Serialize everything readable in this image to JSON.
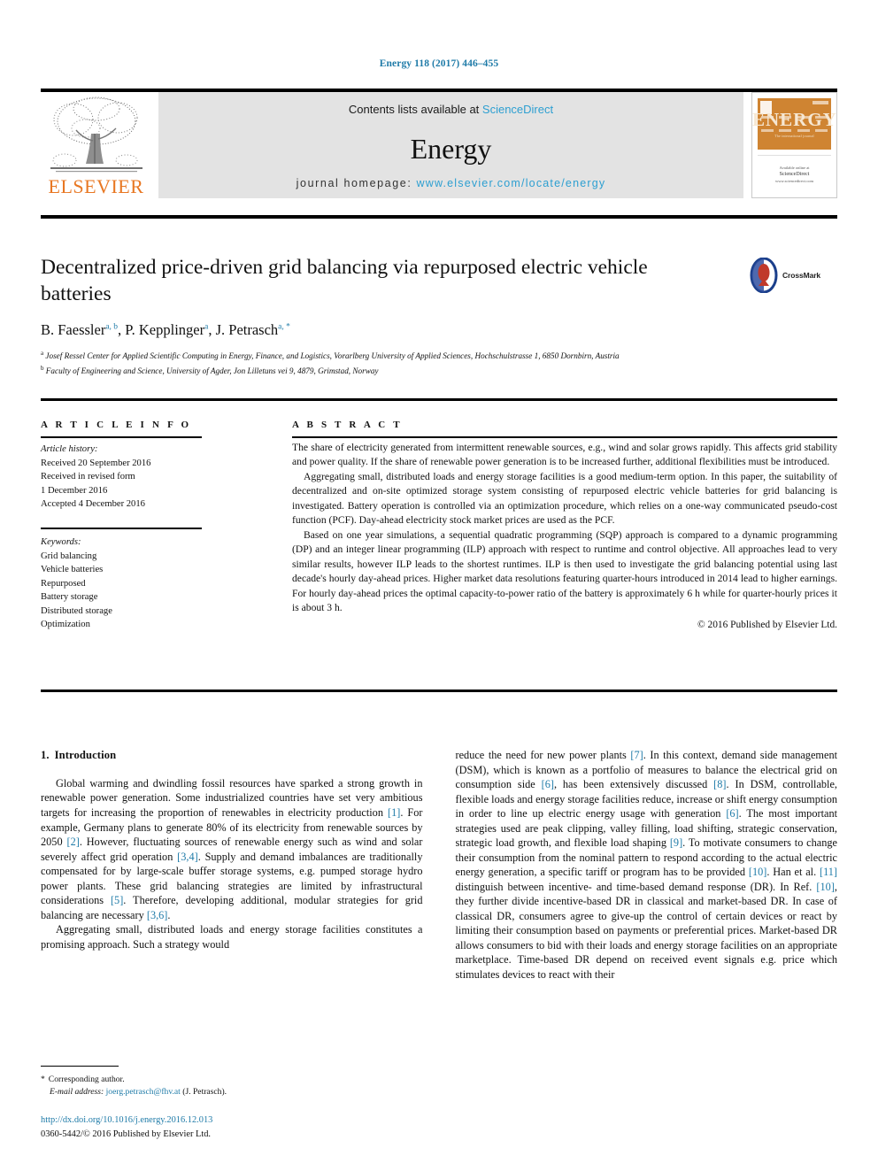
{
  "running_head": "Energy 118 (2017) 446–455",
  "masthead": {
    "contents_prefix": "Contents lists available at ",
    "sciencedirect": "ScienceDirect",
    "journal_name": "Energy",
    "homepage_label": "journal homepage: ",
    "homepage_url": "www.elsevier.com/locate/energy",
    "publisher": "ELSEVIER",
    "cover": {
      "word": "ENERGY",
      "tagline": "The international journal",
      "footer_small": "Available online at",
      "footer_big": "ScienceDirect",
      "footer_url": "www.sciencedirect.com"
    }
  },
  "title": "Decentralized price-driven grid balancing via repurposed electric vehicle batteries",
  "crossmark_label": "CrossMark",
  "authors": [
    {
      "name": "B. Faessler",
      "marks": "a, b",
      "sep": ", "
    },
    {
      "name": "P. Kepplinger",
      "marks": "a",
      "sep": ", "
    },
    {
      "name": "J. Petrasch",
      "marks": "a, *",
      "sep": ""
    }
  ],
  "affiliations": [
    {
      "mark": "a",
      "text": "Josef Ressel Center for Applied Scientific Computing in Energy, Finance, and Logistics, Vorarlberg University of Applied Sciences, Hochschulstrasse 1, 6850 Dornbirn, Austria"
    },
    {
      "mark": "b",
      "text": "Faculty of Engineering and Science, University of Agder, Jon Lilletuns vei 9, 4879, Grimstad, Norway"
    }
  ],
  "article_info": {
    "heading": "A R T I C L E  I N F O",
    "history_label": "Article history:",
    "history_lines": [
      "Received 20 September 2016",
      "Received in revised form",
      "1 December 2016",
      "Accepted 4 December 2016"
    ],
    "keywords_label": "Keywords:",
    "keywords": [
      "Grid balancing",
      "Vehicle batteries",
      "Repurposed",
      "Battery storage",
      "Distributed storage",
      "Optimization"
    ]
  },
  "abstract": {
    "heading": "A B S T R A C T",
    "paragraphs": [
      "The share of electricity generated from intermittent renewable sources, e.g., wind and solar grows rapidly. This affects grid stability and power quality. If the share of renewable power generation is to be increased further, additional flexibilities must be introduced.",
      "Aggregating small, distributed loads and energy storage facilities is a good medium-term option. In this paper, the suitability of decentralized and on-site optimized storage system consisting of repurposed electric vehicle batteries for grid balancing is investigated. Battery operation is controlled via an optimization procedure, which relies on a one-way communicated pseudo-cost function (PCF). Day-ahead electricity stock market prices are used as the PCF.",
      "Based on one year simulations, a sequential quadratic programming (SQP) approach is compared to a dynamic programming (DP) and an integer linear programming (ILP) approach with respect to runtime and control objective. All approaches lead to very similar results, however ILP leads to the shortest runtimes. ILP is then used to investigate the grid balancing potential using last decade's hourly day-ahead prices. Higher market data resolutions featuring quarter-hours introduced in 2014 lead to higher earnings. For hourly day-ahead prices the optimal capacity-to-power ratio of the battery is approximately 6 h while for quarter-hourly prices it is about 3 h."
    ],
    "copyright": "© 2016 Published by Elsevier Ltd."
  },
  "body": {
    "section_number": "1.",
    "section_title": "Introduction",
    "left_column_html": "Global warming and dwindling fossil resources have sparked a strong growth in renewable power generation. Some industrialized countries have set very ambitious targets for increasing the proportion of renewables in electricity production <span class=\"ref\">[1]</span>. For example, Germany plans to generate 80% of its electricity from renewable sources by 2050 <span class=\"ref\">[2]</span>. However, fluctuating sources of renewable energy such as wind and solar severely affect grid operation <span class=\"ref\">[3,4]</span>. Supply and demand imbalances are traditionally compensated for by large-scale buffer storage systems, e.g. pumped storage hydro power plants. These grid balancing strategies are limited by infrastructural considerations <span class=\"ref\">[5]</span>. Therefore, developing additional, modular strategies for grid balancing are necessary <span class=\"ref\">[3,6]</span>.",
    "left_column_html_2": "Aggregating small, distributed loads and energy storage facilities constitutes a promising approach. Such a strategy would",
    "right_column_html": "reduce the need for new power plants <span class=\"ref\">[7]</span>. In this context, demand side management (DSM), which is known as a portfolio of measures to balance the electrical grid on consumption side <span class=\"ref\">[6]</span>, has been extensively discussed <span class=\"ref\">[8]</span>. In DSM, controllable, flexible loads and energy storage facilities reduce, increase or shift energy consumption in order to line up electric energy usage with generation <span class=\"ref\">[6]</span>. The most important strategies used are peak clipping, valley filling, load shifting, strategic conservation, strategic load growth, and flexible load shaping <span class=\"ref\">[9]</span>. To motivate consumers to change their consumption from the nominal pattern to respond according to the actual electric energy generation, a specific tariff or program has to be provided <span class=\"ref\">[10]</span>. Han et al. <span class=\"ref\">[11]</span> distinguish between incentive- and time-based demand response (DR). In Ref. <span class=\"ref\">[10]</span>, they further divide incentive-based DR in classical and market-based DR. In case of classical DR, consumers agree to give-up the control of certain devices or react by limiting their consumption based on payments or preferential prices. Market-based DR allows consumers to bid with their loads and energy storage facilities on an appropriate marketplace. Time-based DR depend on received event signals e.g. price which stimulates devices to react with their"
  },
  "footnote": {
    "corresponding": "Corresponding author.",
    "email_label": "E-mail address:",
    "email": "joerg.petrasch@fhv.at",
    "email_suffix": "(J. Petrasch)."
  },
  "doi": {
    "url": "http://dx.doi.org/10.1016/j.energy.2016.12.013",
    "issn_line": "0360-5442/© 2016 Published by Elsevier Ltd."
  },
  "colors": {
    "link": "#1f7ba8",
    "sciencedirect": "#2d9fd1",
    "elsevier_orange": "#E87722",
    "cover_orange": "#cf8432",
    "masthead_bg": "#e3e3e3"
  }
}
